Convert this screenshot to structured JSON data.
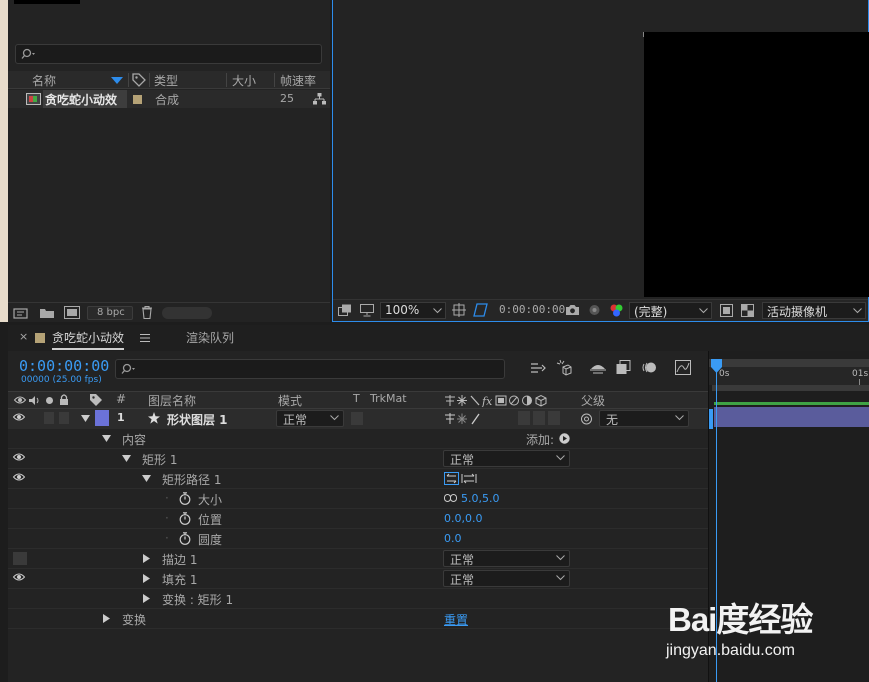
{
  "project": {
    "columns": {
      "name": "名称",
      "type": "类型",
      "size": "大小",
      "fps": "帧速率"
    },
    "item": {
      "name": "贪吃蛇小动效",
      "type": "合成",
      "fps": "25"
    },
    "footer": {
      "bpc": "8 bpc"
    }
  },
  "viewer": {
    "zoom": "100%",
    "timecode": "0:00:00:00",
    "resolution": "(完整)",
    "camera": "活动摄像机"
  },
  "timeline": {
    "tabs": {
      "comp": "贪吃蛇小动效",
      "render": "渲染队列"
    },
    "timecode": "0:00:00:00",
    "fps_text": "00000 (25.00 fps)",
    "columns": {
      "num": "#",
      "layer_name": "图层名称",
      "mode": "模式",
      "t": "T",
      "trkmat": "TrkMat",
      "parent": "父级"
    },
    "layer": {
      "index": "1",
      "name": "形状图层 1",
      "mode": "正常",
      "parent": "无"
    },
    "contents": {
      "label": "内容",
      "add": "添加:"
    },
    "rect": {
      "label": "矩形 1",
      "mode": "正常"
    },
    "path": {
      "label": "矩形路径 1"
    },
    "size": {
      "label": "大小",
      "value": "5.0,5.0"
    },
    "position": {
      "label": "位置",
      "value": "0.0,0.0"
    },
    "roundness": {
      "label": "圆度",
      "value": "0.0"
    },
    "stroke": {
      "label": "描边 1",
      "mode": "正常"
    },
    "fill": {
      "label": "填充 1",
      "mode": "正常"
    },
    "transform_rect": {
      "label": "变换 : 矩形 1"
    },
    "transform": {
      "label": "变换",
      "reset": "重置"
    },
    "ruler": {
      "t0": "0s",
      "t1": "01s"
    }
  },
  "watermark": {
    "logo": "Bai度经验",
    "url": "jingyan.baidu.com"
  },
  "colors": {
    "accent": "#3a9bf4",
    "layer_label": "#6b72d8",
    "project_label": "#b5a276",
    "layer_bar": "#5a5c9c",
    "green": "#3fa345"
  }
}
